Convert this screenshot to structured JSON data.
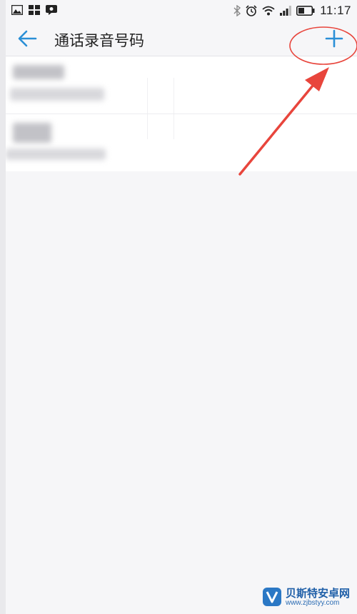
{
  "status_bar": {
    "time": "11:17",
    "icons": [
      "gallery-icon",
      "apps-icon",
      "notification-icon",
      "bluetooth-icon",
      "alarm-icon",
      "wifi-icon",
      "signal-icon",
      "battery-icon"
    ]
  },
  "header": {
    "title": "通话录音号码",
    "back_icon": "back-arrow-icon",
    "add_icon": "plus-icon"
  },
  "list": {
    "items": [
      {
        "name": "",
        "number": "",
        "obscured": true
      },
      {
        "name": "",
        "number": "",
        "obscured": true
      }
    ]
  },
  "annotation": {
    "color": "#e8453c",
    "target": "add-button"
  },
  "colors": {
    "accent": "#2a8fd6",
    "background": "#f6f6f8",
    "list_bg": "#ffffff"
  },
  "watermark": {
    "title": "贝斯特安卓网",
    "url": "www.zjbstyy.com"
  }
}
